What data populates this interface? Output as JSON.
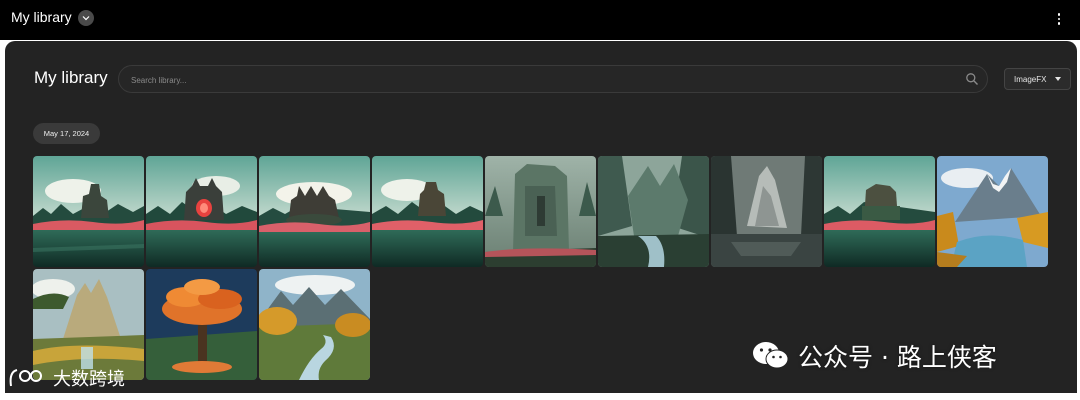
{
  "topbar": {
    "title": "My library",
    "title_dropdown_icon": "chevron-down-icon",
    "menu_icon": "more-vert-icon"
  },
  "library": {
    "title": "My library",
    "search": {
      "placeholder": "Search library...",
      "value": "",
      "icon": "search-icon"
    },
    "source_select": {
      "selected": "ImageFX",
      "icon": "caret-down-icon"
    },
    "date_group": "May 17, 2024",
    "images": [
      {
        "subject": "ruined castle over red flower marsh"
      },
      {
        "subject": "castle with glowing red gate"
      },
      {
        "subject": "castle on rocky island"
      },
      {
        "subject": "castle ruin over red flower marsh"
      },
      {
        "subject": "tall stone ruin in forest"
      },
      {
        "subject": "mountain valley river"
      },
      {
        "subject": "misty mountain lake"
      },
      {
        "subject": "overgrown castle by marsh"
      },
      {
        "subject": "autumn mountain lake"
      },
      {
        "subject": "golden mountain waterfall"
      },
      {
        "subject": "orange autumn tree"
      },
      {
        "subject": "autumn river valley"
      }
    ]
  },
  "watermark": {
    "text": "公众号 · 路上侠客",
    "icon": "wechat-icon"
  },
  "bottom_logo": {
    "text": "大数跨境",
    "icon": "logo-icon"
  }
}
